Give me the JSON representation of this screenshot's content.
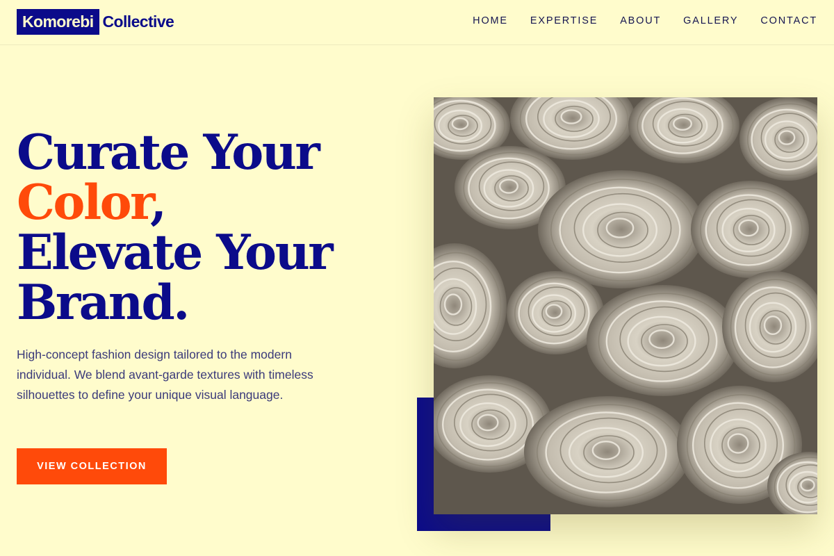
{
  "brand": {
    "name_boxed": "Komorebi",
    "name_rest": "Collective"
  },
  "nav": {
    "items": [
      "HOME",
      "EXPERTISE",
      "ABOUT",
      "GALLERY",
      "CONTACT"
    ]
  },
  "hero": {
    "title_line1": "Curate Your",
    "title_accent": "Color",
    "title_accent_punct": ",",
    "title_line3": "Elevate Your",
    "title_line4": "Brand.",
    "description": "High-concept fashion design tailored to the modern individual. We blend avant-garde textures with timeless silhouettes to define your unique visual language.",
    "cta_label": "VIEW COLLECTION"
  },
  "media": {
    "image_subject": "rolled-fabric-bolts-photo"
  },
  "colors": {
    "background": "#fffccc",
    "primary": "#0b0b8a",
    "accent": "#ff4a0a",
    "body_text": "#3a3a7a"
  }
}
